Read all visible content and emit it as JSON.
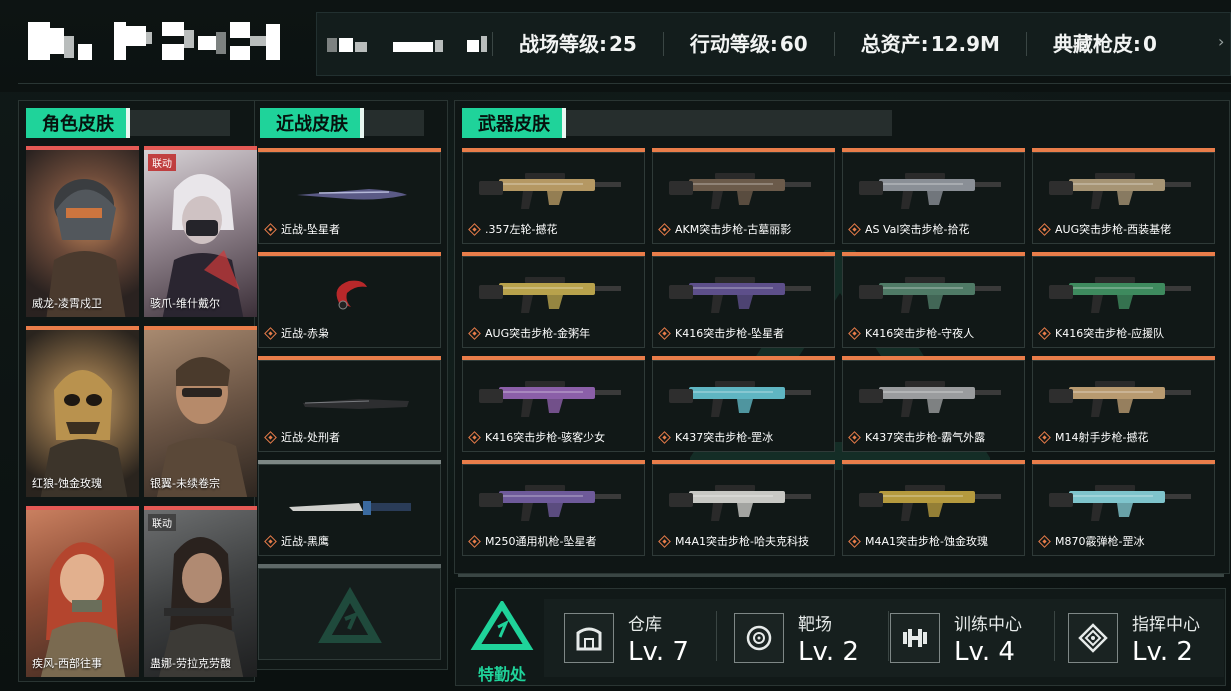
{
  "header": {
    "stats": [
      {
        "label": "战场等级:",
        "value": "25"
      },
      {
        "label": "行动等级:",
        "value": "60"
      },
      {
        "label": "总资产:",
        "value": "12.9M"
      },
      {
        "label": "典藏枪皮:",
        "value": "0"
      }
    ],
    "scroll_arrow": "›"
  },
  "character_panel": {
    "title": "角色皮肤",
    "cards": [
      {
        "name": "威龙-凌霄戍卫",
        "badge": ""
      },
      {
        "name": "骇爪-维什戴尔",
        "badge": "联动"
      },
      {
        "name": "红狼-蚀金玫瑰",
        "badge": ""
      },
      {
        "name": "银翼-未续卷宗",
        "badge": ""
      },
      {
        "name": "疾风-西部往事",
        "badge": ""
      },
      {
        "name": "蛊娜-劳拉克劳馥",
        "badge": "联动"
      }
    ]
  },
  "melee_panel": {
    "title": "近战皮肤",
    "items": [
      {
        "name": "近战-坠星者"
      },
      {
        "name": "近战-赤枭"
      },
      {
        "name": "近战-处刑者"
      },
      {
        "name": "近战-黑鹰"
      }
    ]
  },
  "weapon_panel": {
    "title": "武器皮肤",
    "items": [
      {
        "name": ".357左轮-撼花",
        "color": "#b59863"
      },
      {
        "name": "AKM突击步枪-古墓丽影",
        "color": "#6b5a4a"
      },
      {
        "name": "AS Val突击步枪-拾花",
        "color": "#8a8f96"
      },
      {
        "name": "AUG突击步枪-西装基佬",
        "color": "#a69474"
      },
      {
        "name": "AUG突击步枪-金粥年",
        "color": "#b8a24c"
      },
      {
        "name": "K416突击步枪-坠星者",
        "color": "#5d4f8a"
      },
      {
        "name": "K416突击步枪-守夜人",
        "color": "#4f7a66"
      },
      {
        "name": "K416突击步枪-应援队",
        "color": "#3e8a5e"
      },
      {
        "name": "K416突击步枪-骇客少女",
        "color": "#8b5fa8"
      },
      {
        "name": "K437突击步枪-罡冰",
        "color": "#5fb5c2"
      },
      {
        "name": "K437突击步枪-霸气外露",
        "color": "#9a9c9e"
      },
      {
        "name": "M14射手步枪-撼花",
        "color": "#b89a70"
      },
      {
        "name": "M250通用机枪-坠星者",
        "color": "#6e5a9a"
      },
      {
        "name": "M4A1突击步枪-哈夫克科技",
        "color": "#c8c8c4"
      },
      {
        "name": "M4A1突击步枪-蚀金玫瑰",
        "color": "#b59a3e"
      },
      {
        "name": "M870霰弹枪-罡冰",
        "color": "#7fc4cc"
      }
    ]
  },
  "hq_bar": {
    "title": "特勤处",
    "facilities": [
      {
        "name": "仓库",
        "level": "Lv. 7",
        "icon": "vault-icon"
      },
      {
        "name": "靶场",
        "level": "Lv. 2",
        "icon": "target-icon"
      },
      {
        "name": "训练中心",
        "level": "Lv. 4",
        "icon": "dumbbell-icon"
      },
      {
        "name": "指挥中心",
        "level": "Lv. 2",
        "icon": "command-icon"
      }
    ]
  },
  "colors": {
    "accent": "#1fd39a",
    "orange": "#e97d4a",
    "red": "#e45a55"
  }
}
